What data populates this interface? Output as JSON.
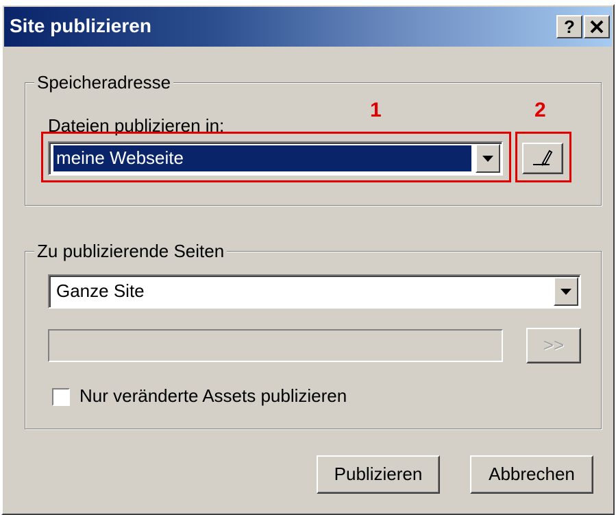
{
  "window": {
    "title": "Site publizieren",
    "help_button": "?",
    "close_button": "✕"
  },
  "storage_group": {
    "legend": "Speicheradresse",
    "label": "Dateien publizieren in:",
    "selected_value": "meine Webseite",
    "annotation_1": "1",
    "annotation_2": "2",
    "edit_icon": "pencil-icon"
  },
  "pages_group": {
    "legend": "Zu publizierende Seiten",
    "selected_value": "Ganze Site",
    "browse_button": ">>",
    "checkbox_label": "Nur veränderte Assets publizieren"
  },
  "actions": {
    "publish": "Publizieren",
    "cancel": "Abbrechen"
  },
  "colors": {
    "annotation": "#e00000",
    "selection": "#0a246a",
    "dialog_bg": "#d4d0c8"
  }
}
